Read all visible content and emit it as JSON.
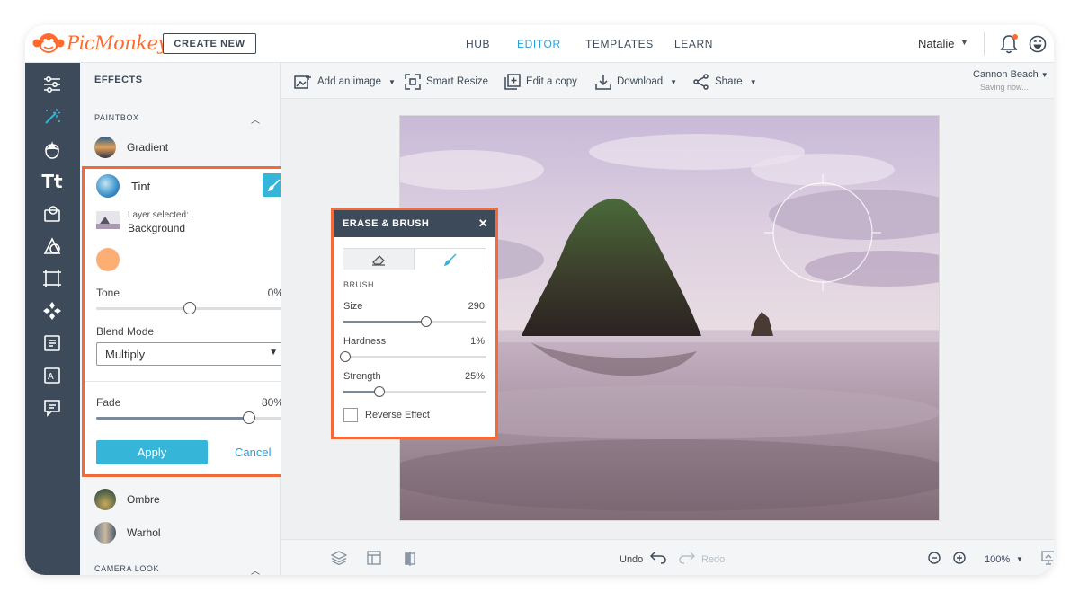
{
  "app": {
    "logo_text": "PicMonkey",
    "create_label": "CREATE NEW"
  },
  "nav": [
    {
      "label": "HUB",
      "active": false
    },
    {
      "label": "EDITOR",
      "active": true
    },
    {
      "label": "TEMPLATES",
      "active": false
    },
    {
      "label": "LEARN",
      "active": false
    }
  ],
  "user": {
    "name": "Natalie"
  },
  "colors": {
    "brand": "#ff6b2c",
    "accent": "#35b5d8",
    "rail": "#3d4a5a",
    "highlight": "#f26a3a",
    "tint": "#fcae74"
  },
  "rail_icons": [
    "adjustments-icon",
    "effects-wand-icon",
    "touch-up-face-icon",
    "text-icon",
    "graphics-icon",
    "textures-icon",
    "frames-icon",
    "themes-icon",
    "templates-icon",
    "stock-icon",
    "comments-icon"
  ],
  "effects_panel": {
    "title": "EFFECTS",
    "paintbox_label": "PAINTBOX",
    "camera_label": "CAMERA LOOK",
    "items": {
      "gradient": "Gradient",
      "ombre": "Ombre",
      "warhol": "Warhol"
    }
  },
  "tint": {
    "name": "Tint",
    "layer_label": "Layer selected:",
    "layer_value": "Background",
    "tone_label": "Tone",
    "tone_value": "0%",
    "tone_fraction": 0.49,
    "blend_label": "Blend Mode",
    "blend_value": "Multiply",
    "fade_label": "Fade",
    "fade_value": "80%",
    "fade_fraction": 0.8,
    "apply_label": "Apply",
    "cancel_label": "Cancel"
  },
  "toolbar": {
    "add_image": "Add an image",
    "smart_resize": "Smart Resize",
    "edit_copy": "Edit a copy",
    "download": "Download",
    "share": "Share",
    "project_name": "Cannon Beach",
    "status": "Saving now..."
  },
  "erase_brush": {
    "title": "ERASE & BRUSH",
    "section": "BRUSH",
    "size_label": "Size",
    "size_value": "290",
    "size_fraction": 0.58,
    "hardness_label": "Hardness",
    "hardness_value": "1%",
    "hardness_fraction": 0.01,
    "strength_label": "Strength",
    "strength_value": "25%",
    "strength_fraction": 0.25,
    "reverse_label": "Reverse Effect"
  },
  "bottom": {
    "undo": "Undo",
    "redo": "Redo",
    "zoom": "100%"
  }
}
